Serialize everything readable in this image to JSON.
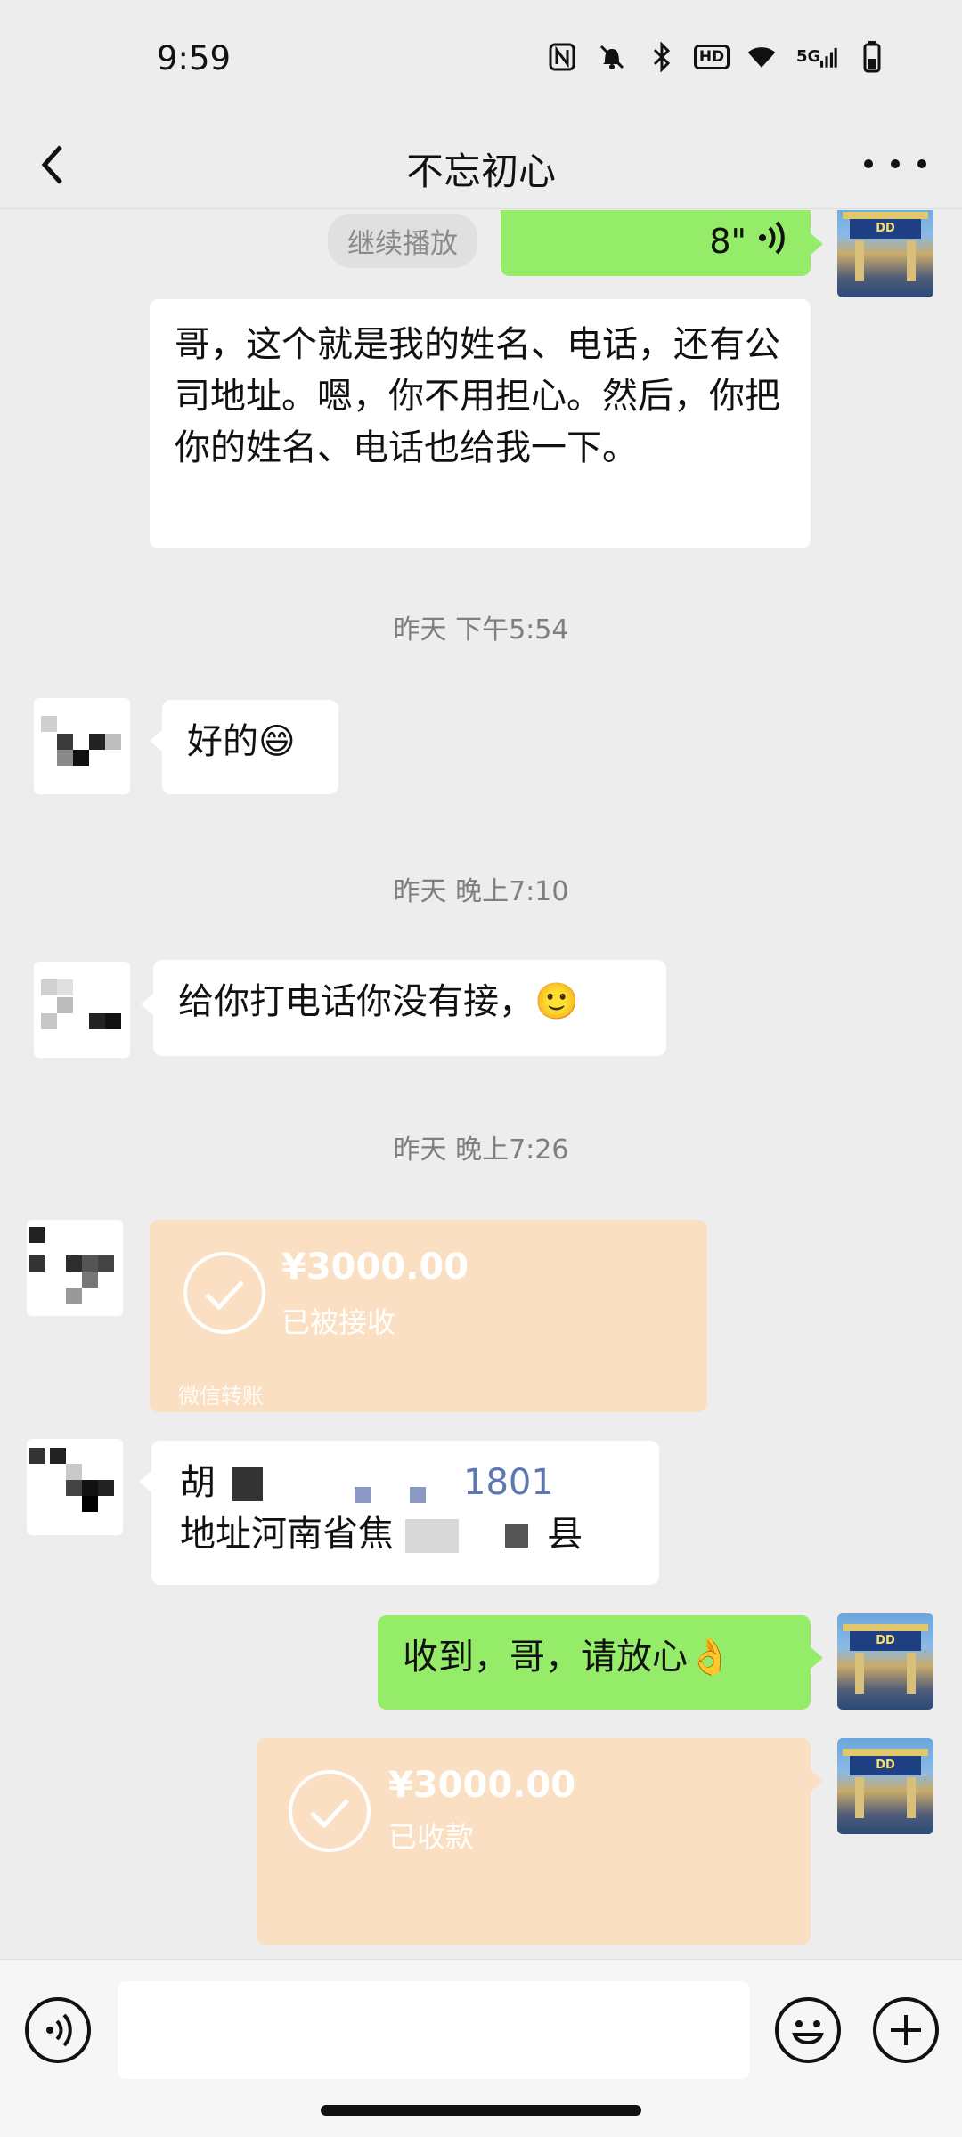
{
  "status_bar": {
    "time": "9:59",
    "icons": [
      "nfc-icon",
      "mute-icon",
      "bluetooth-icon",
      "hd-icon",
      "wifi-icon",
      "5g-signal-icon",
      "battery-icon"
    ],
    "hd_label": "HD",
    "network_label": "5G"
  },
  "header": {
    "title": "不忘初心",
    "back_icon": "chevron-left-icon",
    "more_icon": "more-icon"
  },
  "messages": {
    "voice": {
      "continue_label": "继续播放",
      "duration": "8\""
    },
    "text1": "哥，这个就是我的姓名、电话，还有公司地址。嗯，你不用担心。然后，你把你的姓名、电话也给我一下。",
    "ts1": "昨天 下午5:54",
    "text2": "好的😄",
    "ts2": "昨天 晚上7:10",
    "text3": "给你打电话你没有接，🙂",
    "ts3": "昨天 晚上7:26",
    "transfer1": {
      "amount": "¥3000.00",
      "status": "已被接收",
      "source": "微信转账"
    },
    "text4_line1": "胡",
    "text4_line1_tail": "1801",
    "text4_line2_a": "地址河南省焦",
    "text4_line2_b": "县",
    "text5": "收到，哥，请放心👌",
    "transfer2": {
      "amount": "¥3000.00",
      "status": "已收款"
    }
  },
  "colors": {
    "background": "#ededed",
    "self_bubble": "#95ec69",
    "other_bubble": "#ffffff",
    "transfer": "#fbdfc2"
  }
}
